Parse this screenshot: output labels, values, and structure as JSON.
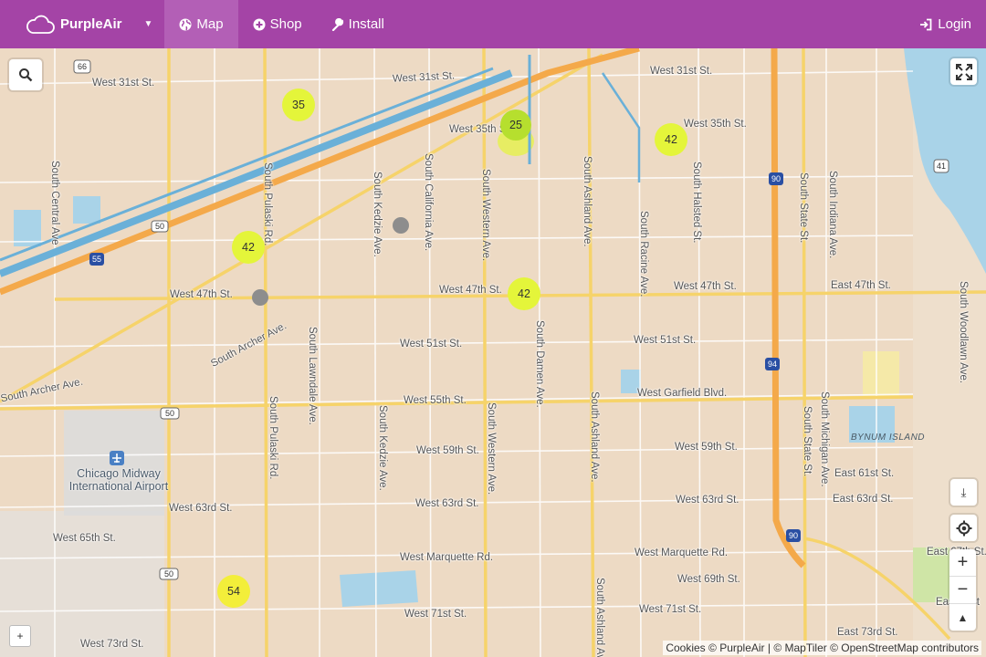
{
  "navbar": {
    "brand": "PurpleAir",
    "menu": [
      {
        "label": "Map",
        "icon": "globe-icon",
        "active": true
      },
      {
        "label": "Shop",
        "icon": "plus-circle-icon"
      },
      {
        "label": "Install",
        "icon": "wrench-icon"
      }
    ],
    "login": "Login",
    "color": "#a444a6"
  },
  "map": {
    "streets": {
      "w31_left": "West 31st St.",
      "w31_mid": "West 31st St.",
      "w31_right": "West 31st St.",
      "w35_mid": "West 35th St.",
      "w35_right": "West 35th St.",
      "w47_left": "West 47th St.",
      "w47_mid": "West 47th St.",
      "w47_right": "West 47th St.",
      "e47": "East 47th St.",
      "w51_mid": "West 51st St.",
      "w51_right": "West 51st St.",
      "w55": "West 55th St.",
      "garfield": "West Garfield Blvd.",
      "w59_mid": "West 59th St.",
      "w59_right": "West 59th St.",
      "e61": "East 61st St.",
      "w63_left": "West 63rd St.",
      "w63_mid": "West 63rd St.",
      "w63_right": "West 63rd St.",
      "e63": "East 63rd St.",
      "w65": "West 65th St.",
      "marquette_mid": "West Marquette Rd.",
      "marquette_right": "West Marquette Rd.",
      "e67": "East 67th St.",
      "w69": "West 69th St.",
      "w71_mid": "West 71st St.",
      "w71_right": "West 71st St.",
      "e71": "East 71st",
      "w73": "West 73rd St.",
      "e73": "East 73rd St.",
      "archer_left": "South Archer Ave.",
      "archer_diag": "South Archer Ave.",
      "central": "South Central Ave",
      "pulaski_n": "South Pulaski Rd.",
      "pulaski_s": "South Pulaski Rd.",
      "kedzie_n": "South Kedzie Ave.",
      "kedzie_s": "South Kedzie Ave.",
      "california": "South California Ave.",
      "lawndale": "South Lawndale Ave.",
      "western_n": "South Western Ave.",
      "western_s": "South Western Ave.",
      "damen": "South Damen Ave.",
      "ashland_n": "South Ashland Ave.",
      "ashland_m": "South Ashland Ave.",
      "ashland_s": "South Ashland Ave.",
      "racine": "South Racine Ave.",
      "halsted": "South Halsted St.",
      "state_n": "South State St.",
      "state_s": "South State St.",
      "indiana": "South Indiana Ave.",
      "michigan": "South Michigan Ave.",
      "woodlawn": "South Woodlawn Ave."
    },
    "highways": [
      "66",
      "50",
      "55",
      "50",
      "50",
      "41",
      "90",
      "94",
      "90"
    ],
    "airport_line1": "Chicago Midway",
    "airport_line2": "International Airport",
    "island": "BYNUM ISLAND",
    "clusters": [
      {
        "value": "35",
        "color": "#e4f53a"
      },
      {
        "value": "25",
        "color": "#b6df2e"
      },
      {
        "value": "42",
        "color": "#e4f53a"
      },
      {
        "value": "42",
        "color": "#e4f53a"
      },
      {
        "value": "42",
        "color": "#e4f53a"
      },
      {
        "value": "54",
        "color": "#f3ee3a"
      }
    ],
    "controls": {
      "search": "search-icon",
      "fullscreen": "fullscreen-icon",
      "download": "⤓",
      "zoom_in": "+",
      "zoom_out": "−",
      "compass": "▲",
      "expand": "+"
    },
    "attribution": "Cookies © PurpleAir | © MapTiler © OpenStreetMap contributors"
  }
}
